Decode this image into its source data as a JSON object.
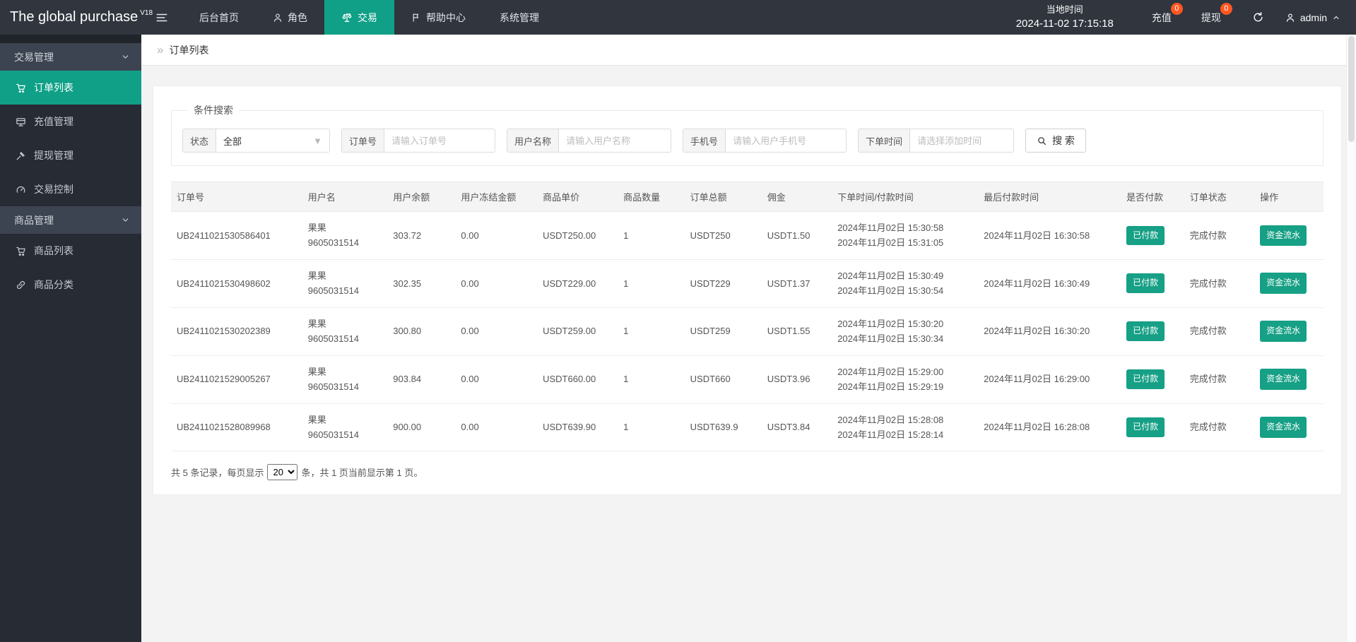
{
  "app": {
    "logo": "The global purchase",
    "logo_version": "V18",
    "nav": [
      {
        "label": "后台首页",
        "icon": null
      },
      {
        "label": "角色",
        "icon": "person"
      },
      {
        "label": "交易",
        "icon": "scales",
        "active": true
      },
      {
        "label": "帮助中心",
        "icon": "flag"
      },
      {
        "label": "系统管理",
        "icon": null
      }
    ],
    "local_time_label": "当地时间",
    "local_time_value": "2024-11-02 17:15:18",
    "recharge": {
      "label": "充值",
      "badge": "0"
    },
    "withdraw": {
      "label": "提现",
      "badge": "0"
    },
    "admin_name": "admin"
  },
  "sidebar": {
    "groups": [
      {
        "label": "交易管理",
        "items": [
          {
            "label": "订单列表",
            "icon": "cart",
            "active": true
          },
          {
            "label": "充值管理",
            "icon": "recharge"
          },
          {
            "label": "提现管理",
            "icon": "gavel"
          },
          {
            "label": "交易控制",
            "icon": "gauge"
          }
        ]
      },
      {
        "label": "商品管理",
        "items": [
          {
            "label": "商品列表",
            "icon": "cart"
          },
          {
            "label": "商品分类",
            "icon": "link"
          }
        ]
      }
    ]
  },
  "breadcrumb": {
    "current": "订单列表"
  },
  "filters": {
    "legend": "条件搜索",
    "status": {
      "label": "状态",
      "value": "全部"
    },
    "order_no": {
      "label": "订单号",
      "placeholder": "请输入订单号"
    },
    "user_name": {
      "label": "用户名称",
      "placeholder": "请输入用户名称"
    },
    "phone": {
      "label": "手机号",
      "placeholder": "请输入用户手机号"
    },
    "order_time": {
      "label": "下单时间",
      "placeholder": "请选择添加时间"
    },
    "search_label": "搜 索"
  },
  "table": {
    "headers": [
      "订单号",
      "用户名",
      "用户余额",
      "用户冻结金额",
      "商品单价",
      "商品数量",
      "订单总额",
      "佣金",
      "下单时间/付款时间",
      "最后付款时间",
      "是否付款",
      "订单状态",
      "操作"
    ],
    "rows": [
      {
        "order_no": "UB2411021530586401",
        "user_name": "果果",
        "user_id": "9605031514",
        "balance": "303.72",
        "frozen": "0.00",
        "unit_price": "USDT250.00",
        "quantity": "1",
        "total": "USDT250",
        "commission": "USDT1.50",
        "order_time": "2024年11月02日 15:30:58",
        "pay_time": "2024年11月02日 15:31:05",
        "last_pay_time": "2024年11月02日 16:30:58",
        "paid_status": "已付款",
        "order_status": "完成付款",
        "action": "资金流水"
      },
      {
        "order_no": "UB2411021530498602",
        "user_name": "果果",
        "user_id": "9605031514",
        "balance": "302.35",
        "frozen": "0.00",
        "unit_price": "USDT229.00",
        "quantity": "1",
        "total": "USDT229",
        "commission": "USDT1.37",
        "order_time": "2024年11月02日 15:30:49",
        "pay_time": "2024年11月02日 15:30:54",
        "last_pay_time": "2024年11月02日 16:30:49",
        "paid_status": "已付款",
        "order_status": "完成付款",
        "action": "资金流水"
      },
      {
        "order_no": "UB2411021530202389",
        "user_name": "果果",
        "user_id": "9605031514",
        "balance": "300.80",
        "frozen": "0.00",
        "unit_price": "USDT259.00",
        "quantity": "1",
        "total": "USDT259",
        "commission": "USDT1.55",
        "order_time": "2024年11月02日 15:30:20",
        "pay_time": "2024年11月02日 15:30:34",
        "last_pay_time": "2024年11月02日 16:30:20",
        "paid_status": "已付款",
        "order_status": "完成付款",
        "action": "资金流水"
      },
      {
        "order_no": "UB2411021529005267",
        "user_name": "果果",
        "user_id": "9605031514",
        "balance": "903.84",
        "frozen": "0.00",
        "unit_price": "USDT660.00",
        "quantity": "1",
        "total": "USDT660",
        "commission": "USDT3.96",
        "order_time": "2024年11月02日 15:29:00",
        "pay_time": "2024年11月02日 15:29:19",
        "last_pay_time": "2024年11月02日 16:29:00",
        "paid_status": "已付款",
        "order_status": "完成付款",
        "action": "资金流水"
      },
      {
        "order_no": "UB2411021528089968",
        "user_name": "果果",
        "user_id": "9605031514",
        "balance": "900.00",
        "frozen": "0.00",
        "unit_price": "USDT639.90",
        "quantity": "1",
        "total": "USDT639.9",
        "commission": "USDT3.84",
        "order_time": "2024年11月02日 15:28:08",
        "pay_time": "2024年11月02日 15:28:14",
        "last_pay_time": "2024年11月02日 16:28:08",
        "paid_status": "已付款",
        "order_status": "完成付款",
        "action": "资金流水"
      }
    ]
  },
  "pagination": {
    "prefix": "共 5 条记录，每页显示",
    "page_size": "20",
    "suffix": "条，共 1 页当前显示第 1 页。"
  },
  "colors": {
    "accent_teal": "#10a088",
    "badge_teal": "#16a085",
    "badge_orange": "#ff5722",
    "topbar_bg": "#30353e",
    "sidebar_bg": "#272b34",
    "sidebar_group_bg": "#3d4451",
    "content_bg": "#f3f3f4"
  }
}
